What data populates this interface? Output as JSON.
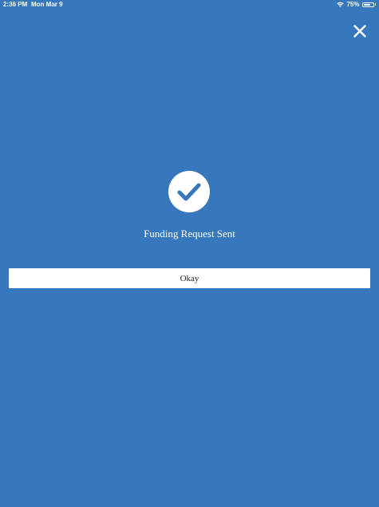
{
  "status_bar": {
    "time": "2:36 PM",
    "date": "Mon Mar 9",
    "battery_percent_label": "75%",
    "battery_level": 0.75,
    "wifi_icon": "wifi-icon",
    "battery_icon": "battery-icon"
  },
  "header": {
    "close_icon": "close-icon"
  },
  "confirmation": {
    "icon": "checkmark-circle-icon",
    "message": "Funding Request Sent",
    "okay_label": "Okay"
  },
  "colors": {
    "background": "#3777bd",
    "accent": "#3777bd",
    "text": "#ffffff",
    "button_background": "#ffffff",
    "button_text": "#222222"
  }
}
